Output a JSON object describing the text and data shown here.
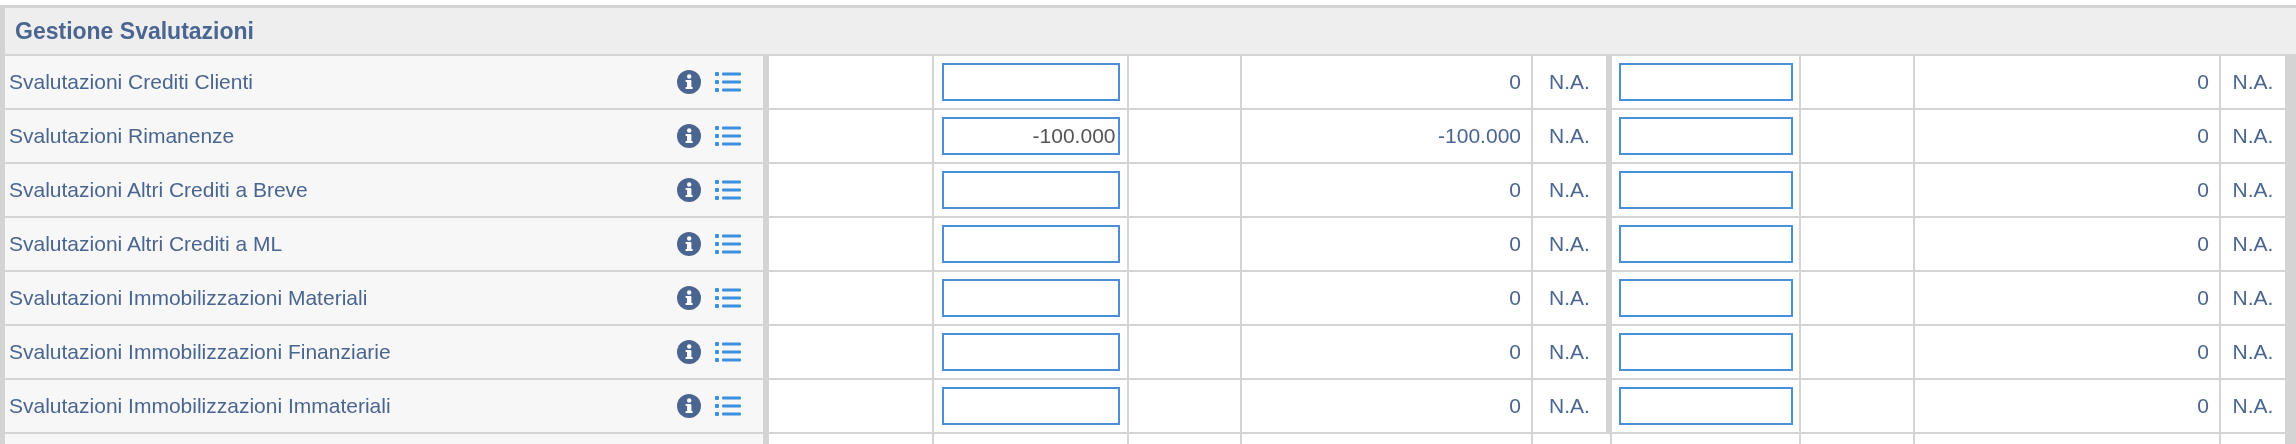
{
  "section": {
    "title": "Gestione Svalutazioni"
  },
  "rows": [
    {
      "label": "Svalutazioni Crediti Clienti",
      "value_1": "0",
      "na_1": "N.A.",
      "value_2": "0",
      "na_2": "N.A."
    },
    {
      "label": "Svalutazioni Rimanenze",
      "input_1": "-100.000",
      "value_1": "-100.000",
      "na_1": "N.A.",
      "value_2": "0",
      "na_2": "N.A."
    },
    {
      "label": "Svalutazioni Altri Crediti a Breve",
      "value_1": "0",
      "na_1": "N.A.",
      "value_2": "0",
      "na_2": "N.A."
    },
    {
      "label": "Svalutazioni Altri Crediti a ML",
      "value_1": "0",
      "na_1": "N.A.",
      "value_2": "0",
      "na_2": "N.A."
    },
    {
      "label": "Svalutazioni Immobilizzazioni Materiali",
      "value_1": "0",
      "na_1": "N.A.",
      "value_2": "0",
      "na_2": "N.A."
    },
    {
      "label": "Svalutazioni Immobilizzazioni Finanziarie",
      "value_1": "0",
      "na_1": "N.A.",
      "value_2": "0",
      "na_2": "N.A."
    },
    {
      "label": "Svalutazioni Immobilizzazioni Immateriali",
      "value_1": "0",
      "na_1": "N.A.",
      "value_2": "0",
      "na_2": "N.A."
    }
  ]
}
